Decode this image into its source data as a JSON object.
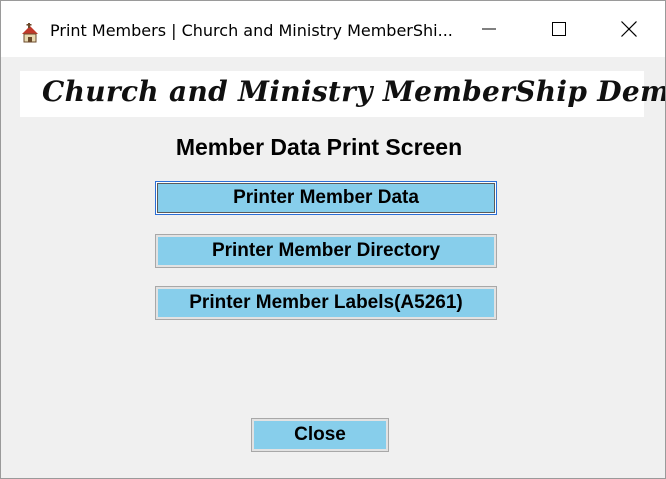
{
  "window": {
    "title": "Print Members | Church and Ministry MemberShi...",
    "app_icon": "app-icon",
    "controls": {
      "minimize_icon": "minimize-icon",
      "maximize_icon": "maximize-icon",
      "close_icon": "close-icon"
    }
  },
  "banner": {
    "text": "Church and Ministry MemberShip Demo"
  },
  "heading": "Member Data Print Screen",
  "buttons": {
    "print_member_data": "Printer Member Data",
    "print_member_directory": "Printer Member Directory",
    "print_member_labels": "Printer Member Labels(A5261)",
    "close": "Close"
  },
  "colors": {
    "button_fill": "#87ceeb",
    "window_background": "#f0f0f0",
    "titlebar_background": "#ffffff",
    "focus_border": "#2b6fd6"
  }
}
